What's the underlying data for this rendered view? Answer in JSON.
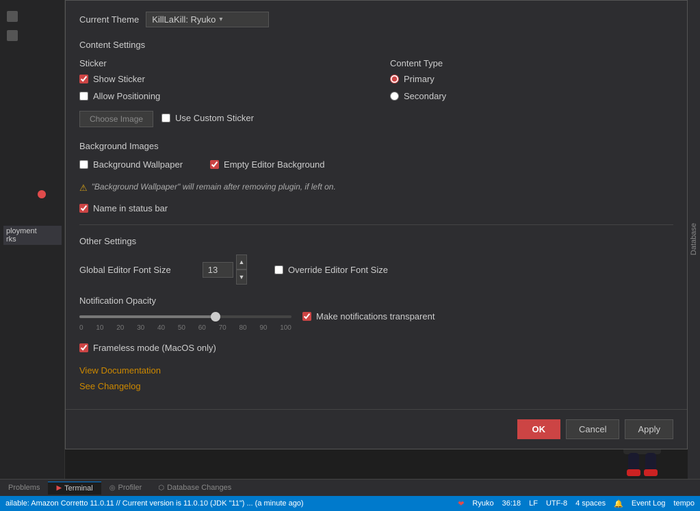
{
  "theme": {
    "label": "Current Theme",
    "value": "KillLaKill: Ryuko",
    "chevron": "▾"
  },
  "content_settings": {
    "title": "Content Settings",
    "sticker_label": "Sticker",
    "content_type_label": "Content Type",
    "show_sticker": {
      "label": "Show Sticker",
      "checked": true
    },
    "allow_positioning": {
      "label": "Allow Positioning",
      "checked": false
    },
    "choose_image_btn": "Choose Image",
    "use_custom_sticker": {
      "label": "Use Custom Sticker",
      "checked": false
    },
    "primary": {
      "label": "Primary",
      "checked": true
    },
    "secondary": {
      "label": "Secondary",
      "checked": false
    }
  },
  "background_images": {
    "title": "Background Images",
    "wallpaper": {
      "label": "Background Wallpaper",
      "checked": false
    },
    "empty_editor": {
      "label": "Empty Editor Background",
      "checked": true
    },
    "warning": "\"Background Wallpaper\" will remain after removing plugin, if left on."
  },
  "name_status_bar": {
    "label": "Name in status bar",
    "checked": true
  },
  "other_settings": {
    "title": "Other Settings",
    "font_size_label": "Global Editor Font Size",
    "font_size_value": "13",
    "override_font_size": {
      "label": "Override Editor Font Size",
      "checked": false
    },
    "notification_opacity_label": "Notification Opacity",
    "slider_value": 65,
    "ticks": [
      "0",
      "10",
      "20",
      "30",
      "40",
      "50",
      "60",
      "70",
      "80",
      "90",
      "100"
    ],
    "make_transparent": {
      "label": "Make notifications transparent",
      "checked": true
    },
    "frameless_mode": {
      "label": "Frameless mode (MacOS only)",
      "checked": true
    }
  },
  "links": {
    "documentation": "View Documentation",
    "changelog": "See Changelog"
  },
  "footer": {
    "ok": "OK",
    "cancel": "Cancel",
    "apply": "Apply"
  },
  "terminal": {
    "tabs": [
      {
        "label": "Problems"
      },
      {
        "label": "Terminal",
        "active": true
      },
      {
        "label": "Profiler"
      },
      {
        "label": "Database Changes"
      }
    ]
  },
  "status_bar": {
    "left_text": "ailable: Amazon Corretto 11.0.11 // Current version is 11.0.10 (JDK \"11\") ... (a minute ago)",
    "heart": "❤",
    "name": "Ryuko",
    "position": "36:18",
    "encoding": "LF",
    "charset": "UTF-8",
    "indent": "4 spaces",
    "event_log": "Event Log",
    "tempo": "tempo"
  },
  "sidebar": {
    "database_label": "Database"
  }
}
